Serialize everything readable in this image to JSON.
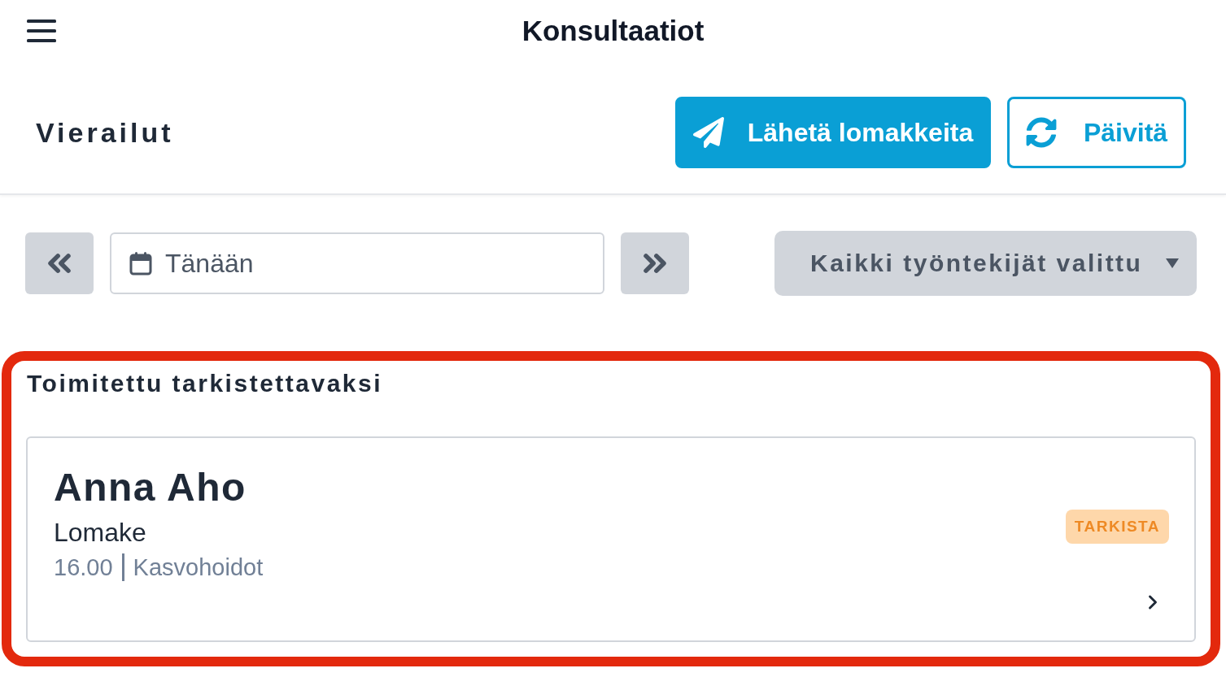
{
  "header": {
    "title": "Konsultaatiot"
  },
  "toolbar": {
    "title": "Vierailut",
    "buttons": [
      {
        "label": "Lähetä lomakkeita",
        "kind": "primary"
      },
      {
        "label": "Päivitä",
        "kind": "outline"
      }
    ]
  },
  "date_nav": {
    "date_field": {
      "value": "Tänään"
    },
    "employee_filter": {
      "label": "Kaikki työntekijät valittu"
    }
  },
  "sections": [
    {
      "title": "Toimitettu tarkistettavaksi",
      "highlighted": true,
      "visits": [
        {
          "name": "Anna Aho",
          "form": "Lomake",
          "time": "16.00",
          "service": "Kasvohoidot",
          "status": {
            "label": "TARKISTA",
            "kind": "review"
          }
        }
      ]
    }
  ]
}
